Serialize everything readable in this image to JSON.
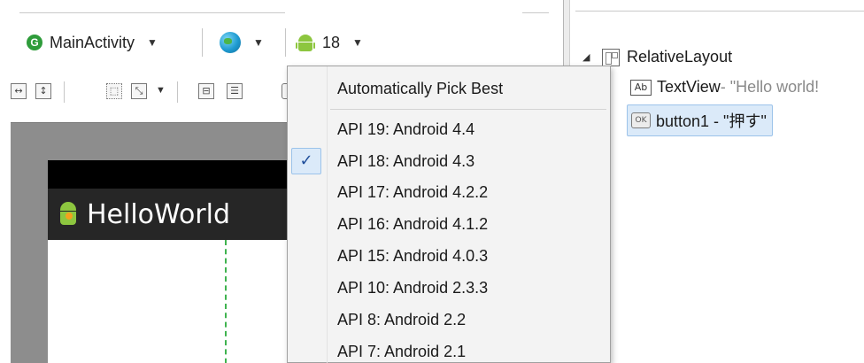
{
  "toolbar": {
    "activity_label": "MainActivity",
    "api_label": "18"
  },
  "preview": {
    "app_title": "HelloWorld"
  },
  "outline": {
    "root": "RelativeLayout",
    "textview_name": "TextView",
    "textview_detail": " - \"Hello world!",
    "button_label": "button1 - \"押す\""
  },
  "api_menu": {
    "auto": "Automatically Pick Best",
    "items": [
      "API 19: Android 4.4",
      "API 18: Android 4.3",
      "API 17: Android 4.2.2",
      "API 16: Android 4.1.2",
      "API 15: Android 4.0.3",
      "API 10: Android 2.3.3",
      "API 8: Android 2.2",
      "API 7: Android 2.1"
    ],
    "selected_index": 1,
    "check_glyph": "✓"
  },
  "icons": {
    "activity": "g-class-icon",
    "locale": "globe-icon",
    "api": "android-icon"
  },
  "colors": {
    "selection": "#dbeaf9",
    "selection_border": "#9cc3ea",
    "android_green": "#8dc63f",
    "guide_green": "#3fb34f"
  }
}
